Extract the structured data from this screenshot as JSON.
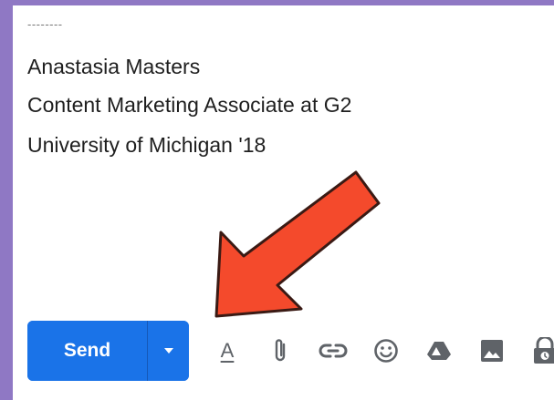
{
  "signature": {
    "dashes": "--------",
    "name": "Anastasia Masters",
    "title": "Content Marketing Associate at G2",
    "school": "University of Michigan '18"
  },
  "toolbar": {
    "send_label": "Send",
    "formatting_letter": "A",
    "icons": [
      "formatting-options-icon",
      "attach-file-icon",
      "insert-link-icon",
      "insert-emoji-icon",
      "google-drive-icon",
      "insert-photo-icon",
      "confidential-mode-icon"
    ]
  },
  "colors": {
    "background_border": "#8f78c4",
    "send_button": "#1a73e8",
    "arrow": "#f44a2c",
    "icon_gray": "#5f6368"
  }
}
